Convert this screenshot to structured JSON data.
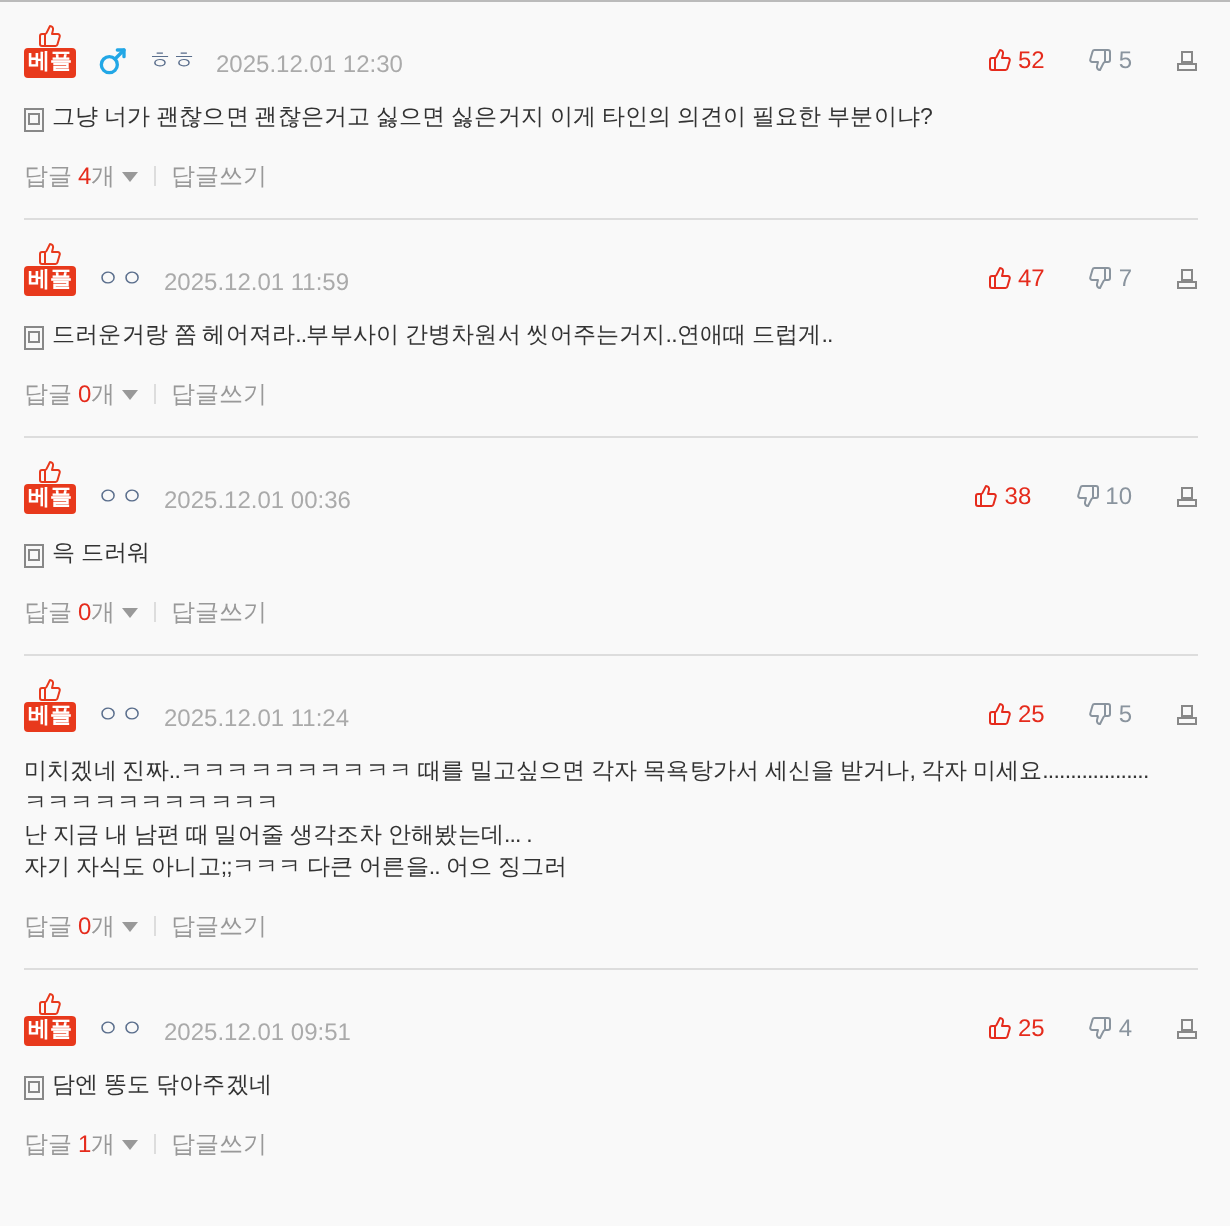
{
  "comments": [
    {
      "badge": "베플",
      "male": true,
      "nickname": "ㅎㅎ",
      "date": "2025.12.01 12:30",
      "likes": "52",
      "dislikes": "5",
      "memo_icon": true,
      "lines": [
        "그냥 너가 괜찮으면 괜찮은거고 싫으면 싫은거지 이게 타인의 의견이 필요한 부분이냐?"
      ],
      "reply_label": "답글",
      "reply_count": "4",
      "reply_unit": "개",
      "write_reply": "답글쓰기"
    },
    {
      "badge": "베플",
      "nickname": "ㅇㅇ",
      "date": "2025.12.01 11:59",
      "likes": "47",
      "dislikes": "7",
      "memo_icon": true,
      "lines": [
        "드러운거랑 쫌 헤어져라..부부사이 간병차원서 씻어주는거지..연애때 드럽게.."
      ],
      "reply_label": "답글",
      "reply_count": "0",
      "reply_unit": "개",
      "write_reply": "답글쓰기"
    },
    {
      "badge": "베플",
      "nickname": "ㅇㅇ",
      "date": "2025.12.01 00:36",
      "likes": "38",
      "dislikes": "10",
      "memo_icon": true,
      "lines": [
        "윽 드러워"
      ],
      "reply_label": "답글",
      "reply_count": "0",
      "reply_unit": "개",
      "write_reply": "답글쓰기"
    },
    {
      "badge": "베플",
      "nickname": "ㅇㅇ",
      "date": "2025.12.01 11:24",
      "likes": "25",
      "dislikes": "5",
      "memo_icon": false,
      "lines": [
        "미치겠네 진짜..ㅋㅋㅋㅋㅋㅋㅋㅋㅋㅋ 때를 밀고싶으면 각자 목욕탕가서 세신을 받거나, 각자 미세요...................",
        "ㅋㅋㅋㅋㅋㅋㅋㅋㅋㅋㅋ",
        "난 지금 내 남편 때 밀어줄 생각조차 안해봤는데... .",
        "자기 자식도 아니고;;ㅋㅋㅋ 다큰 어른을.. 어으 징그러"
      ],
      "reply_label": "답글",
      "reply_count": "0",
      "reply_unit": "개",
      "write_reply": "답글쓰기"
    },
    {
      "badge": "베플",
      "nickname": "ㅇㅇ",
      "date": "2025.12.01 09:51",
      "likes": "25",
      "dislikes": "4",
      "memo_icon": true,
      "lines": [
        "담엔 똥도 닦아주겠네"
      ],
      "reply_label": "답글",
      "reply_count": "1",
      "reply_unit": "개",
      "write_reply": "답글쓰기"
    }
  ]
}
